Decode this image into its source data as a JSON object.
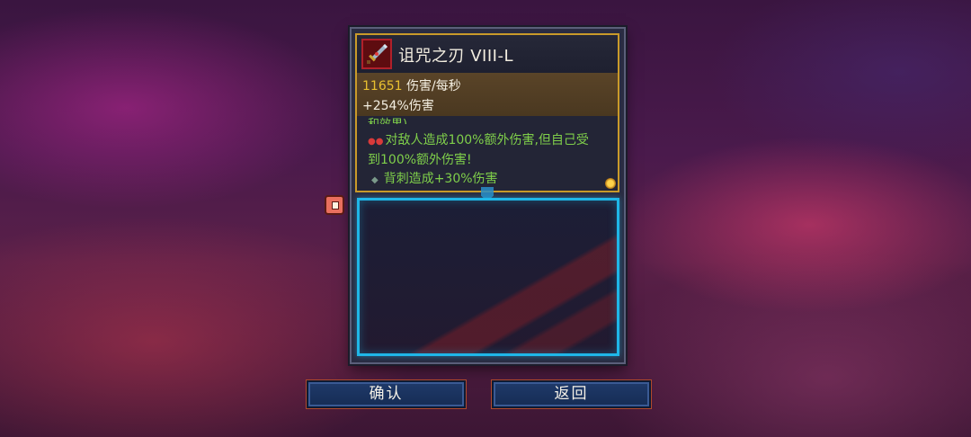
{
  "item": {
    "name": "诅咒之刃 VIII-L",
    "dps_value": "11651",
    "dps_suffix": " 伤害/每秒",
    "damage_bonus": "+254%伤害",
    "desc_cut_line": "和效果)",
    "effect_curse": "对敌人造成100%额外伤害,但自己受",
    "effect_curse_cont": "到100%额外伤害!",
    "effect_backstab": "背刺造成+30%伤害",
    "icon": "cursed-blade-icon"
  },
  "buttons": {
    "confirm": "确认",
    "back": "返回"
  },
  "colors": {
    "gold_frame": "#c99a2a",
    "slot_border": "#1fb7e8",
    "effect_text": "#7fcf4a",
    "dps_number": "#e8c030",
    "button_bg": "#1f3a6a"
  }
}
